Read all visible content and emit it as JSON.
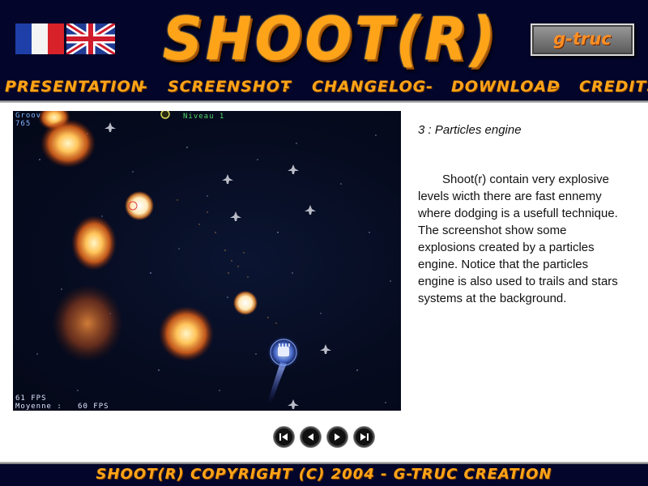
{
  "header": {
    "language_flags": [
      {
        "language": "French",
        "icon": "france-flag-icon"
      },
      {
        "language": "English",
        "icon": "uk-flag-icon"
      }
    ],
    "logo_text": "SHOOT(R)",
    "badge_text": "g-truc",
    "accent_color": "#ffa418",
    "background_color": "#03062a"
  },
  "nav": {
    "items": [
      {
        "label": "Presentation"
      },
      {
        "label": "Screenshot"
      },
      {
        "label": "Changelog"
      },
      {
        "label": "Download"
      },
      {
        "label": "Credits"
      }
    ],
    "separator": "-"
  },
  "screenshot": {
    "hud": {
      "groove_label": "Groov",
      "score": "765",
      "level": "Niveau 1",
      "fps": "61 FPS",
      "average": "Moyenne :   60 FPS"
    }
  },
  "article": {
    "title": "3 : Particles engine",
    "body": "Shoot(r) contain very explosive levels wicth there are fast ennemy where dodging is a usefull technique. The screenshot show some explosions created by a particles engine. Notice that the particles engine is also used to trails and stars systems at the background."
  },
  "controls": [
    {
      "action": "first",
      "icon": "first-icon"
    },
    {
      "action": "previous",
      "icon": "previous-icon"
    },
    {
      "action": "next",
      "icon": "next-icon"
    },
    {
      "action": "last",
      "icon": "last-icon"
    }
  ],
  "footer": {
    "copyright": "Shoot(r) Copyright (c) 2004 - G-Truc Creation"
  }
}
